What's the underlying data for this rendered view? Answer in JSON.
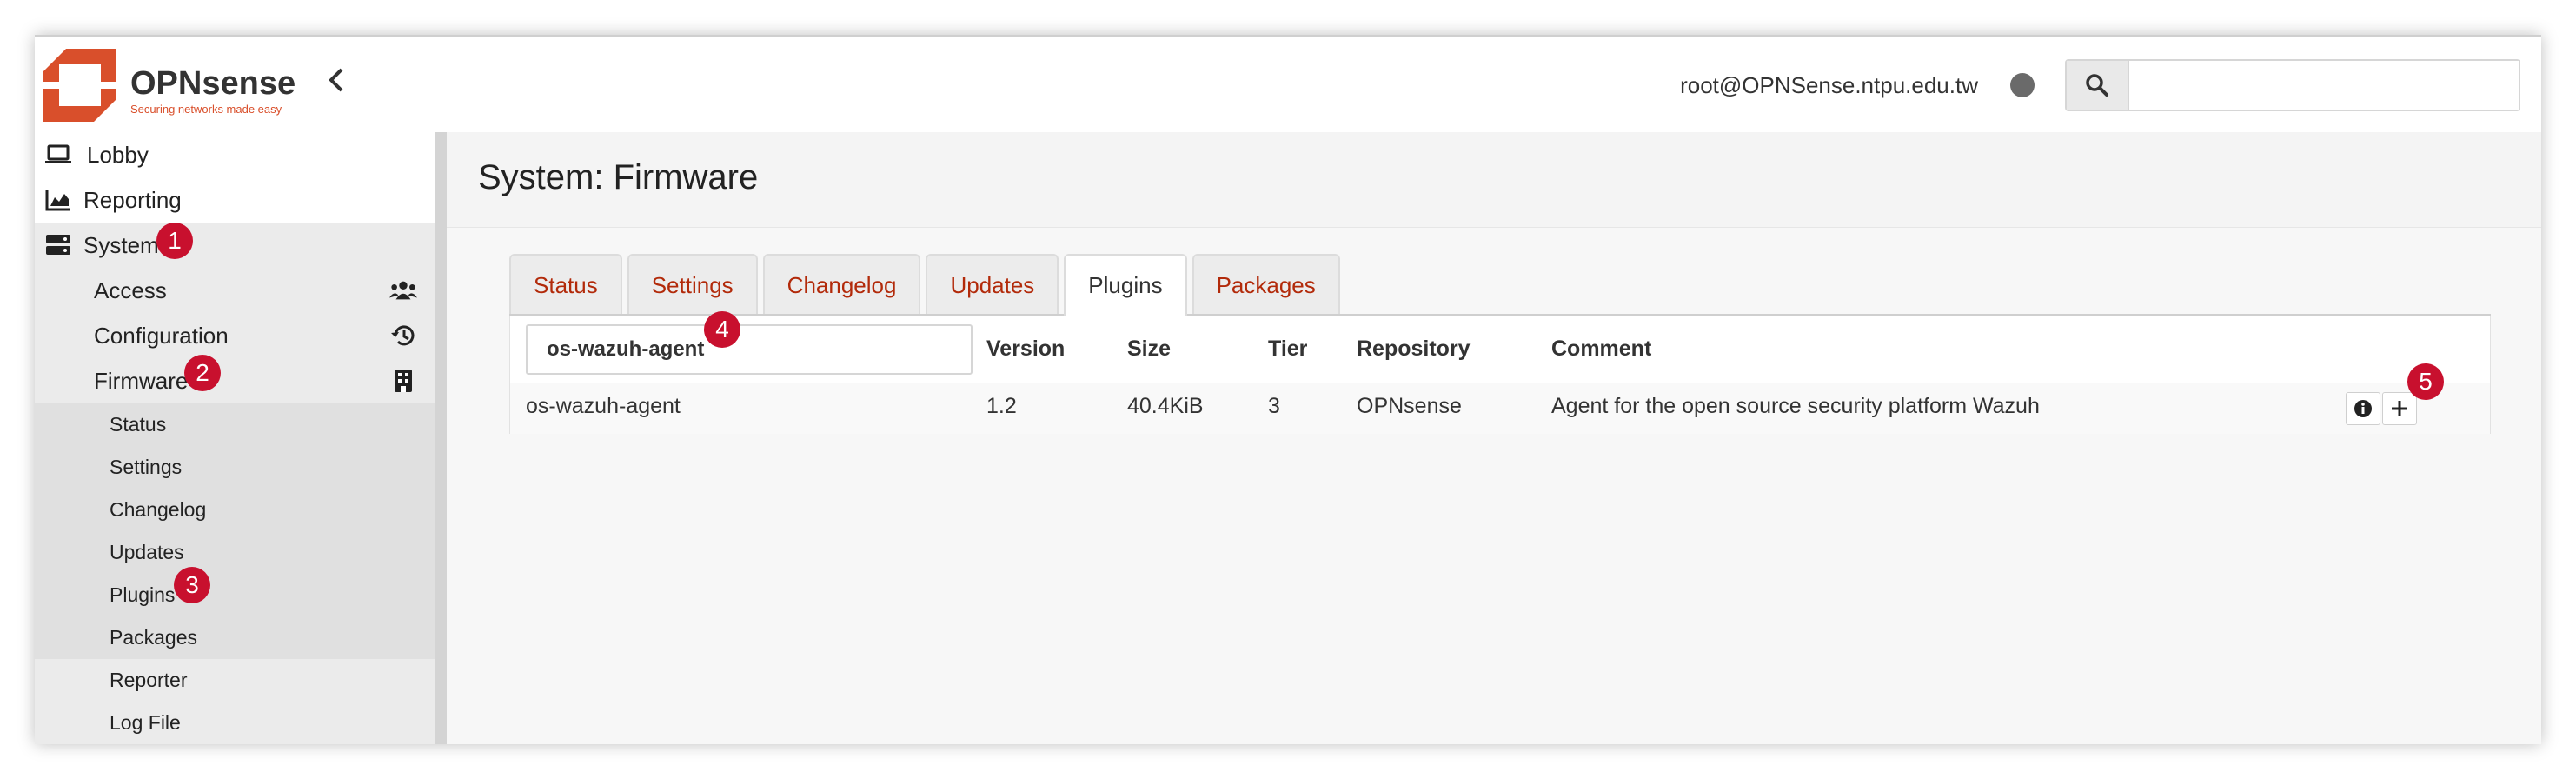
{
  "header": {
    "brand": "OPNsense",
    "tagline": "Securing networks made easy",
    "user": "root@OPNSense.ntpu.edu.tw",
    "search_placeholder": ""
  },
  "sidebar": {
    "top_items": [
      {
        "label": "Lobby",
        "icon": "laptop-icon"
      },
      {
        "label": "Reporting",
        "icon": "chart-icon"
      },
      {
        "label": "System",
        "icon": "server-icon"
      }
    ],
    "system_items": [
      {
        "label": "Access",
        "icon": "users-icon"
      },
      {
        "label": "Configuration",
        "icon": "history-icon"
      },
      {
        "label": "Firmware",
        "icon": "building-icon"
      }
    ],
    "firmware_items": [
      "Status",
      "Settings",
      "Changelog",
      "Updates",
      "Plugins",
      "Packages"
    ],
    "other_items": [
      "Reporter",
      "Log File"
    ]
  },
  "badges": [
    "1",
    "2",
    "3",
    "4",
    "5"
  ],
  "page": {
    "title": "System: Firmware",
    "tabs": [
      "Status",
      "Settings",
      "Changelog",
      "Updates",
      "Plugins",
      "Packages"
    ],
    "active_tab": "Plugins"
  },
  "table": {
    "filter_value": "os-wazuh-agent",
    "columns": [
      "Version",
      "Size",
      "Tier",
      "Repository",
      "Comment"
    ],
    "rows": [
      {
        "name": "os-wazuh-agent",
        "version": "1.2",
        "size": "40.4KiB",
        "tier": "3",
        "repository": "OPNsense",
        "comment": "Agent for the open source security platform Wazuh"
      }
    ]
  },
  "colors": {
    "accent": "#c8102e",
    "tab_link": "#b22a0a"
  }
}
